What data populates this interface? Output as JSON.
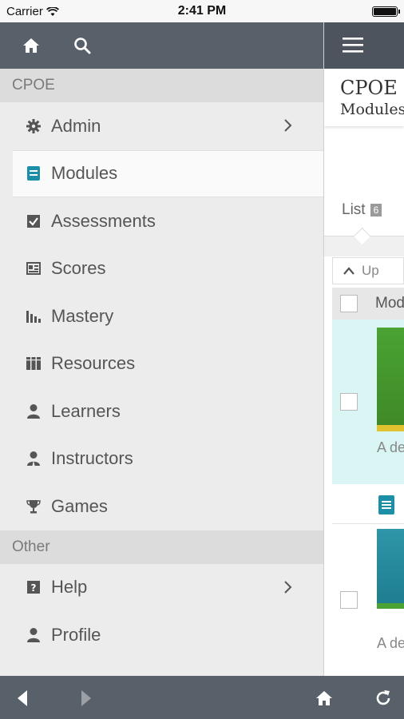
{
  "status_bar": {
    "carrier": "Carrier",
    "time": "2:41 PM"
  },
  "drawer": {
    "sections": [
      {
        "label": "CPOE",
        "items": [
          {
            "label": "Admin",
            "icon": "gear-icon",
            "has_submenu": true
          },
          {
            "label": "Modules",
            "icon": "modules-icon",
            "active": true
          },
          {
            "label": "Assessments",
            "icon": "checkbox-icon"
          },
          {
            "label": "Scores",
            "icon": "scores-icon"
          },
          {
            "label": "Mastery",
            "icon": "bar-chart-icon"
          },
          {
            "label": "Resources",
            "icon": "books-icon"
          },
          {
            "label": "Learners",
            "icon": "person-icon"
          },
          {
            "label": "Instructors",
            "icon": "instructor-icon"
          },
          {
            "label": "Games",
            "icon": "trophy-icon"
          }
        ]
      },
      {
        "label": "Other",
        "items": [
          {
            "label": "Help",
            "icon": "help-icon",
            "has_submenu": true
          },
          {
            "label": "Profile",
            "icon": "person-icon"
          }
        ]
      }
    ]
  },
  "content": {
    "title": "CPOE",
    "subtitle": "Modules",
    "tab_label": "List",
    "tab_count": "6",
    "up_label": "Up",
    "column_header": "Mod",
    "row_desc_1": "A de",
    "row_desc_2": "A de"
  },
  "colors": {
    "accent_teal": "#1b8fa6",
    "header_gray": "#58606a",
    "row_highlight": "#d9f5f4"
  }
}
